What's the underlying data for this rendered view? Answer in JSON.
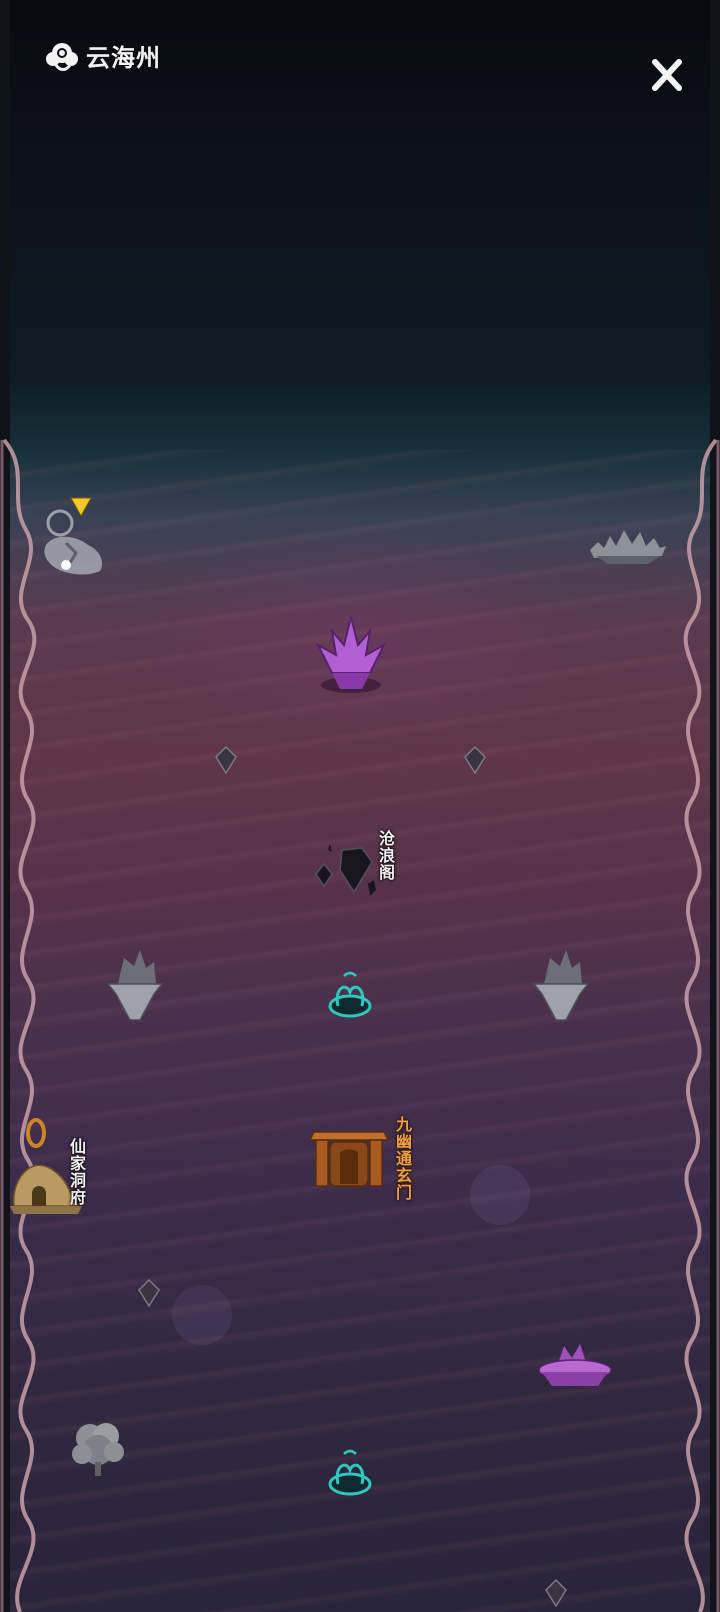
{
  "header": {
    "title": "云海州",
    "logo_icon": "cloud-swirl-icon",
    "close_icon": "close-x-icon"
  },
  "map": {
    "locations": [
      {
        "id": "canglang",
        "label": "沧浪阁",
        "icon": "dark-floating-rocks-icon"
      },
      {
        "id": "jiuyou",
        "label": "九幽通玄门",
        "icon": "bronze-gate-icon"
      },
      {
        "id": "xianjia",
        "label": "仙家洞府",
        "icon": "golden-cave-icon"
      }
    ],
    "player_marker": {
      "icon": "yellow-arrow-marker-icon"
    }
  },
  "colors": {
    "title": "#f2f2f2",
    "label_white": "#f0f0f0",
    "label_orange": "#f0a040",
    "portal_teal": "#2fc8c0",
    "crystal_purple": "#b060d0"
  }
}
